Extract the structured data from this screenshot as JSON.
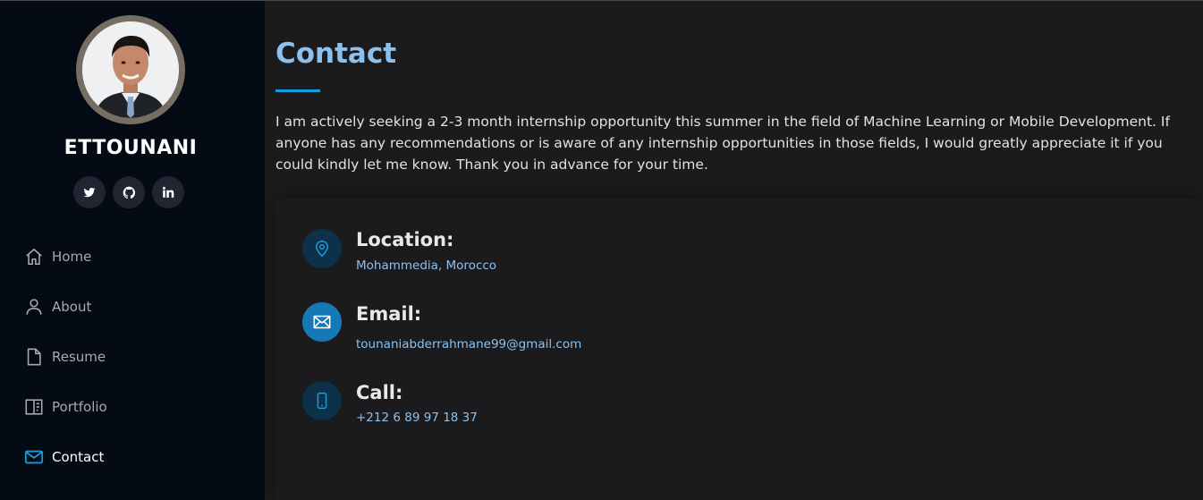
{
  "profile": {
    "name": "ETTOUNANI"
  },
  "social": [
    {
      "icon": "twitter-icon"
    },
    {
      "icon": "github-icon"
    },
    {
      "icon": "linkedin-icon"
    }
  ],
  "nav": {
    "items": [
      {
        "label": "Home",
        "icon": "home-icon"
      },
      {
        "label": "About",
        "icon": "person-icon"
      },
      {
        "label": "Resume",
        "icon": "file-icon"
      },
      {
        "label": "Portfolio",
        "icon": "book-icon"
      },
      {
        "label": "Contact",
        "icon": "envelope-icon",
        "active": true
      }
    ]
  },
  "main": {
    "title": "Contact",
    "intro": "I am actively seeking a 2-3 month internship opportunity this summer in the field of Machine Learning or Mobile Development. If anyone has any recommendations or is aware of any internship opportunities in those fields, I would greatly appreciate it if you could kindly let me know. Thank you in advance for your time."
  },
  "info": {
    "location": {
      "label": "Location:",
      "value": "Mohammedia, Morocco",
      "icon": "map-pin-icon"
    },
    "email": {
      "label": "Email:",
      "value": "tounaniabderrahmane99@gmail.com",
      "icon": "envelope-icon"
    },
    "call": {
      "label": "Call:",
      "value": "+212 6 89 97 18 37",
      "icon": "phone-icon"
    }
  },
  "colors": {
    "sidebar_bg": "#040b14",
    "main_bg": "#1b1b1d",
    "accent": "#149ddd",
    "title": "#8cc1ee"
  }
}
